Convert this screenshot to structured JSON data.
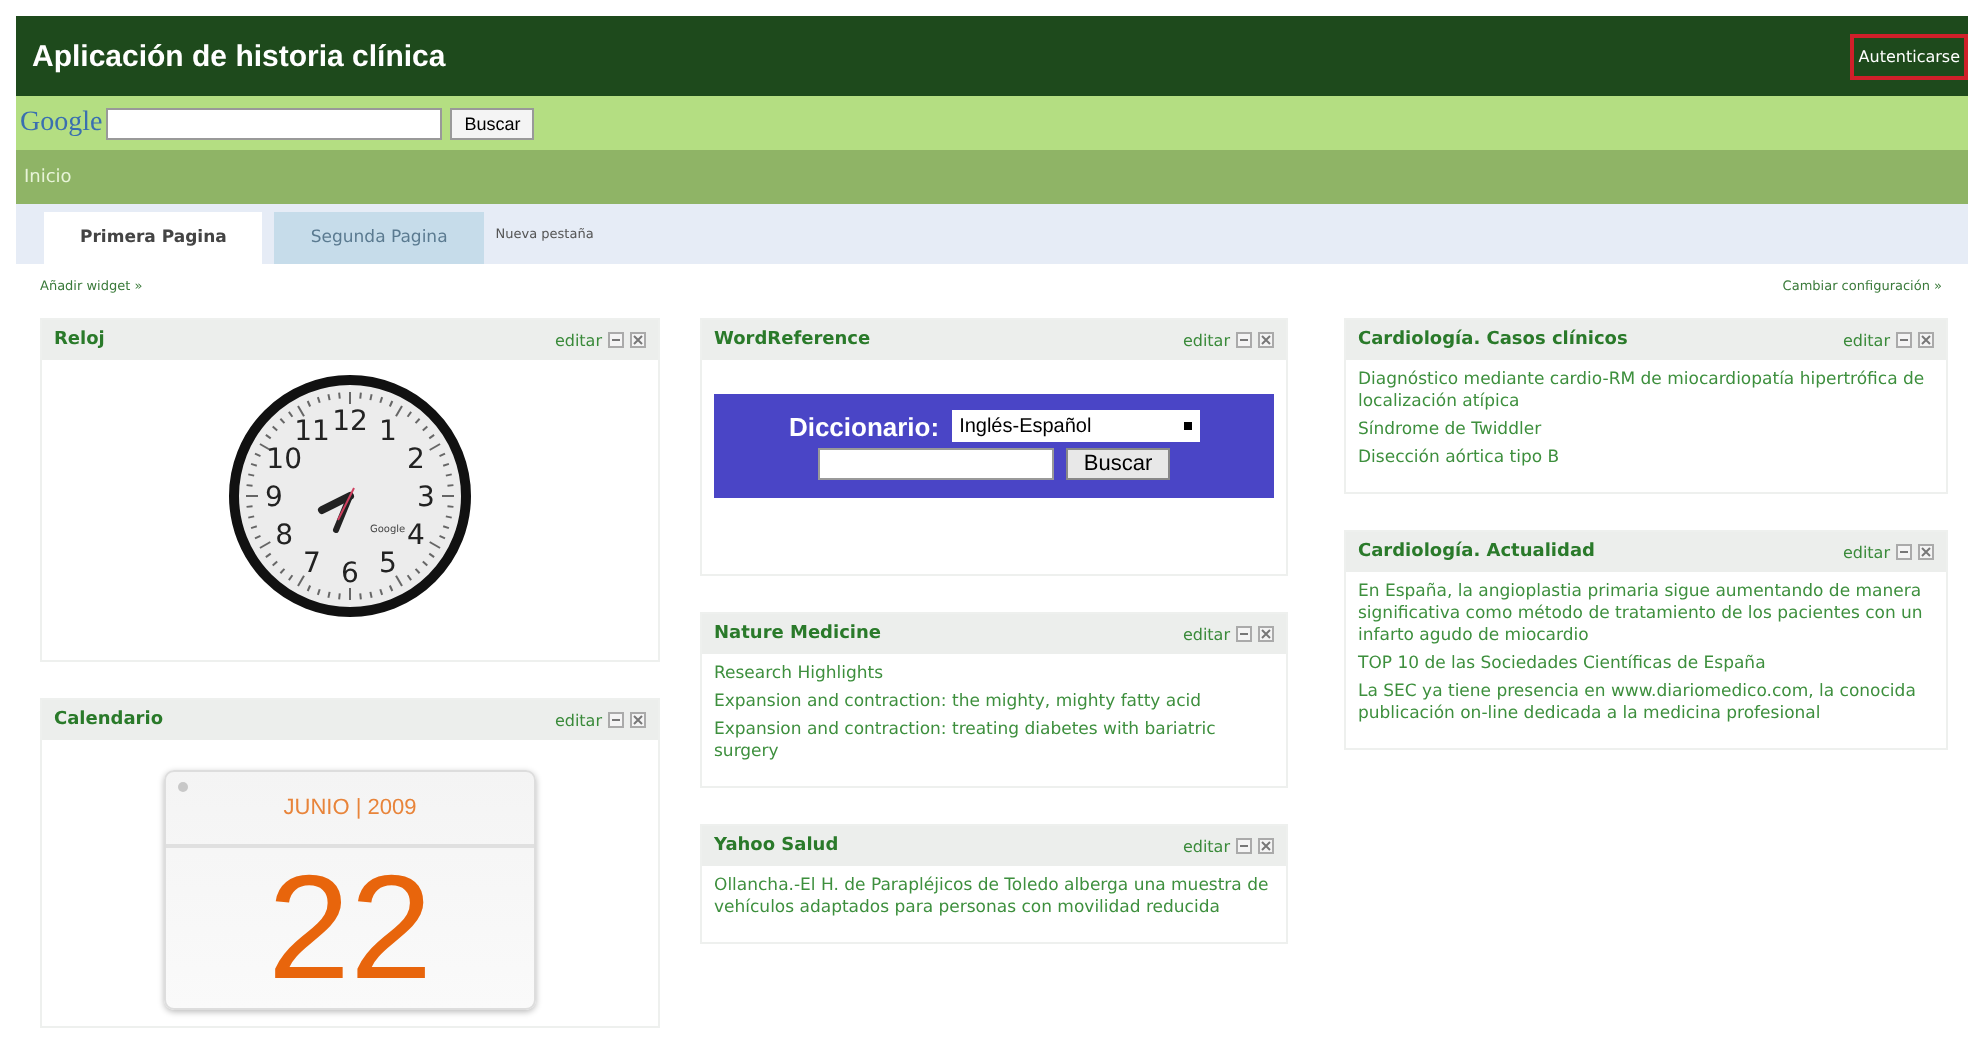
{
  "header": {
    "title": "Aplicación de historia clínica",
    "login_button": "Autenticarse"
  },
  "search_bar": {
    "logo": "Google",
    "button": "Buscar"
  },
  "nav_bar": {
    "item": "Inicio"
  },
  "tabs": [
    {
      "label": "Primera Pagina",
      "selected": true
    },
    {
      "label": "Segunda Pagina",
      "selected": false
    }
  ],
  "new_tab_link": "Nueva pestaña",
  "add_widget_link": "Añadir widget »",
  "settings_link": "Cambiar configuración »",
  "columns": [
    [
      {
        "title": "Reloj",
        "edit": "editar",
        "kind": "clock",
        "numerals": [
          "12",
          "11",
          "1",
          "10",
          "2",
          "9",
          "3",
          "8",
          "4",
          "7",
          "5",
          "6"
        ],
        "brand": "Google"
      },
      {
        "title": "Calendario",
        "edit": "editar",
        "kind": "calendar",
        "month": "JUNIO | 2009",
        "day": "22"
      }
    ],
    [
      {
        "title": "WordReference",
        "edit": "editar",
        "kind": "dictionary",
        "label": "Diccionario:",
        "language": "Inglés-Español",
        "button": "Buscar"
      },
      {
        "title": "Nature Medicine",
        "edit": "editar",
        "kind": "links",
        "items": [
          "Research Highlights",
          "Expansion and contraction: the mighty, mighty fatty acid",
          "Expansion and contraction: treating diabetes with bariatric surgery"
        ]
      },
      {
        "title": "Yahoo Salud",
        "edit": "editar",
        "kind": "links",
        "items": [
          "Ollancha.-El H. de Parapléjicos de Toledo alberga una muestra de vehículos adaptados para personas con movilidad reducida"
        ]
      }
    ],
    [
      {
        "title": "Cardiología. Casos clínicos",
        "edit": "editar",
        "kind": "links",
        "items": [
          "Diagnóstico mediante cardio-RM de miocardiopatía hipertrófica de localización atípica",
          "Síndrome de Twiddler",
          "Disección aórtica tipo B"
        ]
      },
      {
        "title": "Cardiología. Actualidad",
        "edit": "editar",
        "kind": "links",
        "items": [
          "En España, la angioplastia primaria sigue aumentando de manera significativa como método de tratamiento de los pacientes con un infarto agudo de miocardio",
          "TOP 10 de las Sociedades Científicas de España",
          "La SEC ya tiene presencia en www.diariomedico.com, la conocida publicación on-line dedicada a la medicina profesional"
        ]
      }
    ]
  ]
}
